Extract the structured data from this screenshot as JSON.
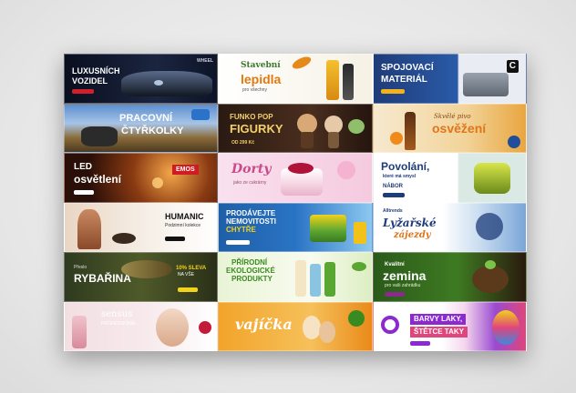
{
  "banners": {
    "b1": {
      "line1": "LUXUSNÍCH",
      "line2": "VOZIDEL",
      "brand": "WHEEL"
    },
    "b2": {
      "line1": "Stavební",
      "line2": "lepidla",
      "sub": "pro všechny"
    },
    "b3": {
      "line1": "SPOJOVACÍ",
      "line2": "MATERIÁL",
      "logo": "C"
    },
    "b4": {
      "line1": "PRACOVNÍ",
      "line2": "ČTYŘKOLKY"
    },
    "b5": {
      "line1": "FUNKO POP",
      "line2": "FIGURKY",
      "price": "OD 299 Kč"
    },
    "b6": {
      "line1": "Skvělé pivo",
      "line2": "osvěžení"
    },
    "b7": {
      "line1": "LED",
      "line2": "osvětlení",
      "brand": "EMOS"
    },
    "b8": {
      "line1": "Dorty",
      "sub": "jako ze cukrárny"
    },
    "b9": {
      "line1": "Povolání,",
      "line2": "které má smysl",
      "badge": "NÁBOR"
    },
    "b10": {
      "brand": "HUMANIC",
      "sub": "Podzimní kolekce"
    },
    "b11": {
      "line1": "PRODÁVEJTE",
      "line2": "NEMOVITOSTI",
      "line3": "CHYTŘE"
    },
    "b12": {
      "brand": "Alltrends",
      "line1": "Lyžařské",
      "line2": "zájezdy"
    },
    "b13": {
      "line1": "Přeslo",
      "line2": "RYBAŘINA",
      "promo1": "10% SLEVA",
      "promo2": "NA VŠE"
    },
    "b14": {
      "line1": "PŘÍRODNÍ",
      "line2": "EKOLOGICKÉ",
      "line3": "PRODUKTY"
    },
    "b15": {
      "line1": "Kvalitní",
      "line2": "zemina",
      "sub": "pro vaši zahrádku"
    },
    "b16": {
      "brand": "sensus",
      "sub": "PROFESSIONAL"
    },
    "b17": {
      "line1": "vajíčka"
    },
    "b18": {
      "line1": "BARVY LAKY,",
      "line2": "ŠTĚTCE TAKY"
    }
  },
  "colors": {
    "accent_orange": "#f29a1f",
    "accent_pink": "#e0457b",
    "accent_green": "#5aa632",
    "accent_blue": "#1f5fa8"
  }
}
